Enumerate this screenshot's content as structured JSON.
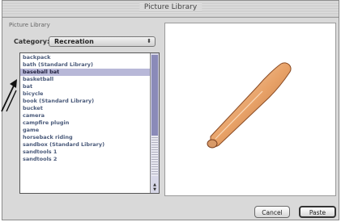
{
  "window": {
    "title": "Picture Library"
  },
  "group_label": "Picture Library",
  "category": {
    "label": "Category:",
    "value": "Recreation",
    "arrows": "⬍"
  },
  "list": {
    "items": [
      {
        "label": "backpack",
        "selected": false
      },
      {
        "label": "bath (Standard Library)",
        "selected": false
      },
      {
        "label": "baseball bat",
        "selected": true
      },
      {
        "label": "basketball",
        "selected": false
      },
      {
        "label": "bat",
        "selected": false
      },
      {
        "label": "bicycle",
        "selected": false
      },
      {
        "label": "book (Standard Library)",
        "selected": false
      },
      {
        "label": "bucket",
        "selected": false
      },
      {
        "label": "camera",
        "selected": false
      },
      {
        "label": "campfire plugin",
        "selected": false
      },
      {
        "label": "game",
        "selected": false
      },
      {
        "label": "horseback riding",
        "selected": false
      },
      {
        "label": "sandbox (Standard Library)",
        "selected": false
      },
      {
        "label": "sandtools 1",
        "selected": false
      },
      {
        "label": "sandtools 2",
        "selected": false
      }
    ]
  },
  "preview": {
    "image": "baseball-bat"
  },
  "buttons": {
    "cancel": "Cancel",
    "paste": "Paste"
  }
}
